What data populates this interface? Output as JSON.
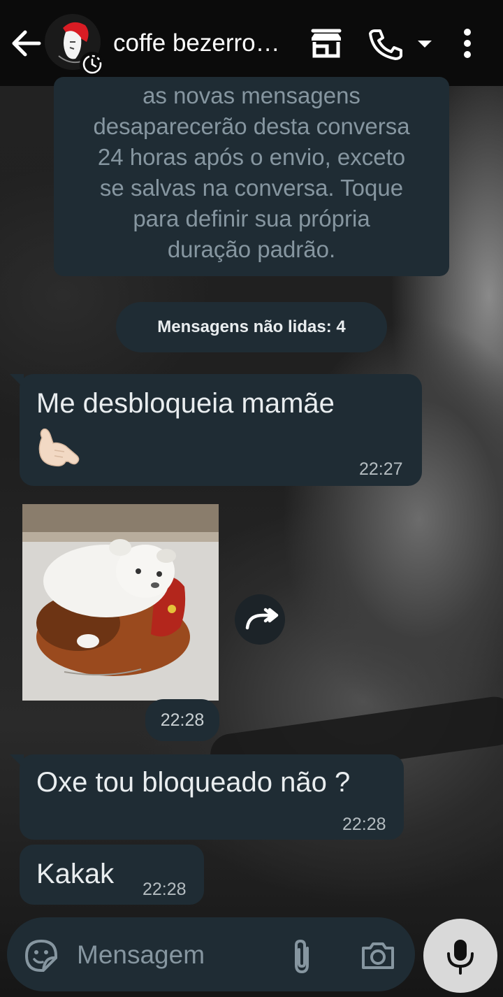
{
  "header": {
    "contact_name": "coffe bezerro…",
    "icons": [
      "back-arrow-icon",
      "store-icon",
      "phone-icon",
      "dropdown-caret-icon",
      "overflow-menu-icon"
    ]
  },
  "system_notice": {
    "text_lines": [
      "as novas mensagens",
      "desaparecerão desta conversa",
      "24 horas após o envio, exceto",
      "se salvas na conversa. Toque",
      "para definir sua própria",
      "duração padrão."
    ]
  },
  "unread_pill": "Mensagens não lidas: 4",
  "messages": [
    {
      "text": "Me desbloqueia mamãe",
      "emoji": "🤙",
      "time": "22:27"
    },
    {
      "type": "image",
      "description_icon": "puppy-on-rooster-image",
      "time": "22:28"
    },
    {
      "text": "Oxe  tou bloqueado não ?",
      "time": "22:28"
    },
    {
      "text": "Kakak",
      "time": "22:28"
    }
  ],
  "composer": {
    "placeholder": "Mensagem",
    "icons": [
      "sticker-icon",
      "attach-icon",
      "camera-icon",
      "mic-icon"
    ]
  },
  "colors": {
    "topbar": "#0b0b0b",
    "bubble": "#1f2c34",
    "secondary_text": "#8696a0",
    "mic_button": "#d9d9d9"
  }
}
